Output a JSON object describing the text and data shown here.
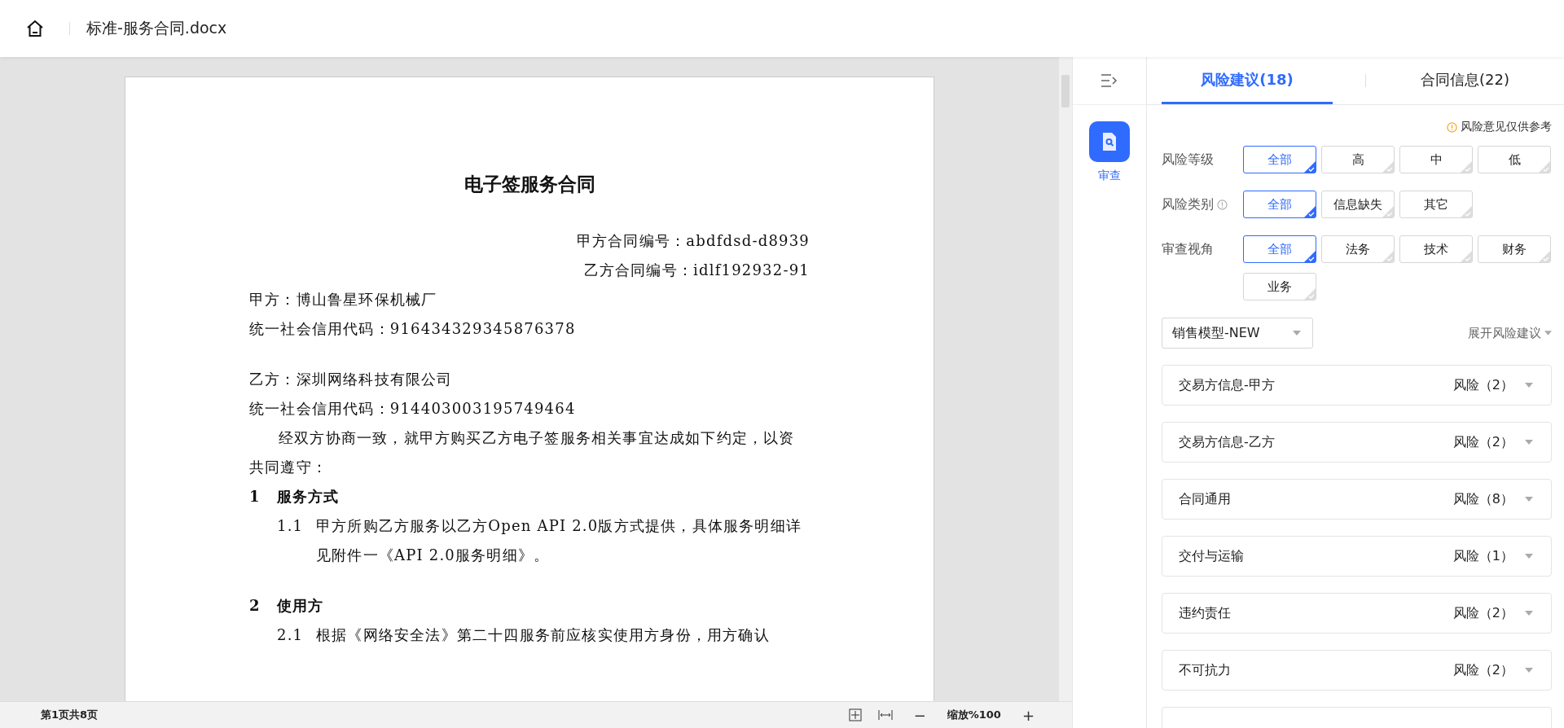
{
  "header": {
    "filename": "标准-服务合同.docx"
  },
  "document": {
    "title": "电子签服务合同",
    "blocks": [
      {
        "kind": "right",
        "text": "甲方合同编号：abdfdsd-d8939"
      },
      {
        "kind": "right",
        "text": "乙方合同编号：idlf192932-91"
      },
      {
        "kind": "line",
        "text": "甲方：博山鲁星环保机械厂"
      },
      {
        "kind": "line",
        "text": "统一社会信用代码：916434329345876378"
      },
      {
        "kind": "blank"
      },
      {
        "kind": "line",
        "text": "乙方：深圳网络科技有限公司"
      },
      {
        "kind": "line",
        "text": "统一社会信用代码：914403003195749464"
      },
      {
        "kind": "para",
        "text": "经双方协商一致，就甲方购买乙方电子签服务相关事宜达成如下约定，以资共同遵守："
      },
      {
        "kind": "heading",
        "num": "1",
        "text": "服务方式"
      },
      {
        "kind": "clause",
        "num": "1.1",
        "text": "甲方所购乙方服务以乙方Open API 2.0版方式提供，具体服务明细详见附件一《API 2.0服务明细》。"
      },
      {
        "kind": "blank"
      },
      {
        "kind": "heading",
        "num": "2",
        "text": "使用方"
      },
      {
        "kind": "clause",
        "num": "2.1",
        "text": "根据《网络安全法》第二十四服务前应核实使用方身份，用方确认"
      }
    ]
  },
  "status_bar": {
    "page": "第1页共8页",
    "zoom_label": "缩放%100",
    "minus": "−",
    "plus": "+"
  },
  "side_rail": {
    "review_label": "审查",
    "review_selected": true
  },
  "panel": {
    "tabs": [
      {
        "label": "风险建议(18)",
        "selected": true
      },
      {
        "label": "合同信息(22)",
        "selected": false
      }
    ],
    "notice": "风险意见仅供参考",
    "filters": [
      {
        "label": "风险等级",
        "info": false,
        "options": [
          {
            "label": "全部",
            "selected": true
          },
          {
            "label": "高",
            "selected": false
          },
          {
            "label": "中",
            "selected": false
          },
          {
            "label": "低",
            "selected": false
          }
        ]
      },
      {
        "label": "风险类别",
        "info": true,
        "options": [
          {
            "label": "全部",
            "selected": true
          },
          {
            "label": "信息缺失",
            "selected": false
          },
          {
            "label": "其它",
            "selected": false
          }
        ]
      },
      {
        "label": "审查视角",
        "info": false,
        "options": [
          {
            "label": "全部",
            "selected": true
          },
          {
            "label": "法务",
            "selected": false
          },
          {
            "label": "技术",
            "selected": false
          },
          {
            "label": "财务",
            "selected": false
          },
          {
            "label": "业务",
            "selected": false
          }
        ]
      }
    ],
    "model_select": "销售模型-NEW",
    "expand_link": "展开风险建议",
    "groups": [
      {
        "title": "交易方信息-甲方",
        "count": "风险（2）"
      },
      {
        "title": "交易方信息-乙方",
        "count": "风险（2）"
      },
      {
        "title": "合同通用",
        "count": "风险（8）"
      },
      {
        "title": "交付与运输",
        "count": "风险（1）"
      },
      {
        "title": "违约责任",
        "count": "风险（2）"
      },
      {
        "title": "不可抗力",
        "count": "风险（2）"
      }
    ]
  }
}
